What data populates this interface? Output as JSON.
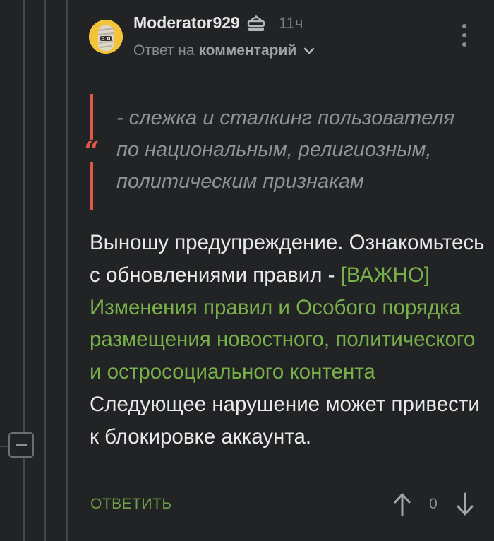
{
  "comment": {
    "author": "Moderator929",
    "time": "11ч",
    "reply_prefix": "Ответ на",
    "reply_link": "комментарий",
    "quote_lines": [
      "- слежка и сталкинг пользователя",
      "по национальным, религиозным,",
      "политическим признакам"
    ],
    "body_before": "Выношу предупреждение. Ознакомьтесь с обновлениями правил - ",
    "rules_link": "[ВАЖНО] Изменения правил и Особого порядка размещения новостного, политического и остросоциального контента",
    "body_after": "Следующее нарушение может привести к блокировке аккаунта.",
    "reply_button": "ОТВЕТИТЬ",
    "rating": "0"
  },
  "icons": {
    "avatar": "avatar-mummy-icon",
    "moderator": "moderator-hat-icon",
    "chevron": "chevron-down-icon",
    "more": "more-vertical-icon",
    "quote": "quote-icon",
    "vote_up": "arrow-up-icon",
    "vote_down": "arrow-down-icon",
    "collapse": "minus-icon"
  },
  "colors": {
    "background": "#222325",
    "quote_accent": "#e0584a",
    "link_green": "#78b04a",
    "text": "#e8e9ea",
    "muted": "#8a8d91"
  }
}
